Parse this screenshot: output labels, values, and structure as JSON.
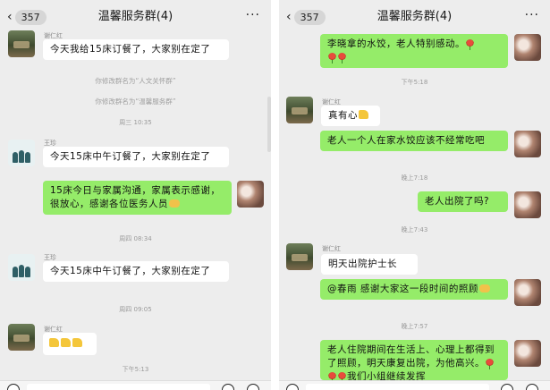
{
  "left": {
    "header": {
      "back_count": "357",
      "title": "温馨服务群(4)",
      "more": "···"
    },
    "messages": {
      "m1": {
        "sender": "谢仁红",
        "text": "今天我给15床订餐了，大家别在定了"
      },
      "sys1": "你修改群名为“人文关怀群”",
      "sys2": "你修改群名为“温馨服务群”",
      "t1": "周三 10:35",
      "m2": {
        "sender": "王珍",
        "text": "今天15床中午订餐了，大家别在定了"
      },
      "m3": {
        "text": "15床今日与家属沟通，家属表示感谢，很放心，感谢各位医务人员"
      },
      "t2": "周四 08:34",
      "m4": {
        "sender": "王珍",
        "text": "今天15床中午订餐了，大家别在定了"
      },
      "t3": "周四 09:05",
      "m5": {
        "sender": "谢仁红"
      },
      "t4": "下午5:13"
    }
  },
  "right": {
    "header": {
      "back_count": "357",
      "title": "温馨服务群(4)",
      "more": "···"
    },
    "messages": {
      "r1": {
        "text": "李晓拿的水饺，老人特别感动。"
      },
      "t1": "下午5:18",
      "r2": {
        "sender": "谢仁红",
        "text": "真有心"
      },
      "r3": {
        "text": "老人一个人在家水饺应该不经常吃吧"
      },
      "t2": "晚上7:18",
      "r4": {
        "text": "老人出院了吗?"
      },
      "t3": "晚上7:43",
      "r5": {
        "sender": "谢仁红",
        "text": "明天出院护士长"
      },
      "r6": {
        "text": "@春雨 感谢大家这一段时间的照顾"
      },
      "t4": "晚上7:57",
      "r7": {
        "text": "老人住院期间在生活上、心理上都得到了照顾，明天康复出院，为他高兴。",
        "tail": "我们小组继续发挥"
      }
    }
  },
  "icons": {
    "back": "chevron-left-icon",
    "more": "more-dots-icon",
    "voice": "voice-icon",
    "emoji": "emoji-icon",
    "add": "add-icon",
    "flower": "rose-emoji-icon",
    "thumb": "thumbs-up-emoji-icon",
    "fist": "fist-emoji-icon"
  },
  "colors": {
    "chat_background": "#ededed",
    "sent_bubble": "#95ec69",
    "received_bubble": "#ffffff",
    "timestamp_text": "#9a9a9a"
  }
}
